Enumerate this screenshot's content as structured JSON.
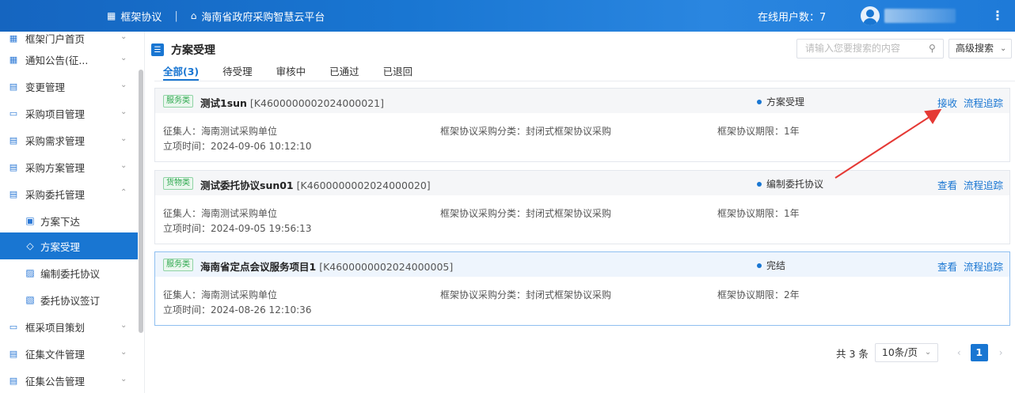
{
  "topbar": {
    "module": "框架协议",
    "platform": "海南省政府采购智慧云平台",
    "online_label": "在线用户数：7"
  },
  "sidebar": {
    "items": [
      {
        "label": "框架门户首页",
        "icon": "grid-icon"
      },
      {
        "label": "通知公告(征...",
        "icon": "grid-icon"
      },
      {
        "label": "变更管理",
        "icon": "doc-edit-icon"
      },
      {
        "label": "采购项目管理",
        "icon": "folder-icon"
      },
      {
        "label": "采购需求管理",
        "icon": "doc-icon"
      },
      {
        "label": "采购方案管理",
        "icon": "doc-icon"
      },
      {
        "label": "采购委托管理",
        "icon": "doc-icon"
      }
    ],
    "sub_items": [
      {
        "label": "方案下达",
        "icon": "send-doc-icon"
      },
      {
        "label": "方案受理",
        "icon": "diamond-icon"
      },
      {
        "label": "编制委托协议",
        "icon": "edit-doc-icon"
      },
      {
        "label": "委托协议签订",
        "icon": "sign-doc-icon"
      }
    ],
    "items_after": [
      {
        "label": "框采项目策划",
        "icon": "folder-icon"
      },
      {
        "label": "征集文件管理",
        "icon": "doc-icon"
      },
      {
        "label": "征集公告管理",
        "icon": "doc-icon"
      }
    ]
  },
  "main": {
    "title": "方案受理",
    "search_placeholder": "请输入您要搜索的内容",
    "advanced_search": "高级搜索",
    "tabs": [
      "全部(3)",
      "待受理",
      "审核中",
      "已通过",
      "已退回"
    ],
    "cards": [
      {
        "tag": "服务类",
        "name": "测试1sun",
        "code": "[K4600000002024000021]",
        "status": "方案受理",
        "actions": [
          "接收",
          "流程追踪"
        ],
        "collector": "征集人：海南测试采购单位",
        "category": "框架协议采购分类：封闭式框架协议采购",
        "period": "框架协议期限：1年",
        "time": "立项时间：2024-09-06 10:12:10"
      },
      {
        "tag": "货物类",
        "name": "测试委托协议sun01",
        "code": "[K4600000002024000020]",
        "status": "编制委托协议",
        "actions": [
          "查看",
          "流程追踪"
        ],
        "collector": "征集人：海南测试采购单位",
        "category": "框架协议采购分类：封闭式框架协议采购",
        "period": "框架协议期限：1年",
        "time": "立项时间：2024-09-05 19:56:13"
      },
      {
        "tag": "服务类",
        "name": "海南省定点会议服务项目1",
        "code": "[K4600000002024000005]",
        "status": "完结",
        "actions": [
          "查看",
          "流程追踪"
        ],
        "collector": "征集人：海南测试采购单位",
        "category": "框架协议采购分类：封闭式框架协议采购",
        "period": "框架协议期限：2年",
        "time": "立项时间：2024-08-26 12:10:36"
      }
    ],
    "pager": {
      "total": "共 3 条",
      "page_size": "10条/页",
      "current": "1"
    }
  },
  "colors": {
    "primary": "#1976d2",
    "arrow": "#e53935",
    "tag_green": "#2fa84f"
  }
}
